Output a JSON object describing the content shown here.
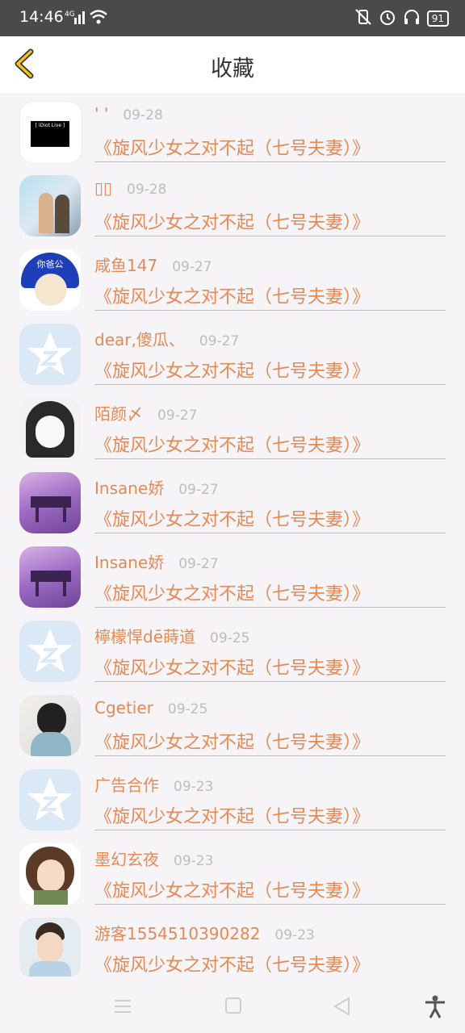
{
  "status": {
    "time": "14:46",
    "network": "4G",
    "battery": "91"
  },
  "header": {
    "title": "收藏"
  },
  "favorites": [
    {
      "name": "' '",
      "date": "09-28",
      "content": "《旋风少女之对不起（七号夫妻）》",
      "avatar": "idiot-live-logo"
    },
    {
      "name": "▯▯",
      "date": "09-28",
      "content": "《旋风少女之对不起（七号夫妻）》",
      "avatar": "couple-photo"
    },
    {
      "name": "咸鱼147",
      "date": "09-27",
      "content": "《旋风少女之对不起（七号夫妻）》",
      "avatar": "helmet-meme"
    },
    {
      "name": "dear,傻瓜、",
      "date": "09-27",
      "content": "《旋风少女之对不起（七号夫妻）》",
      "avatar": "qzone-default"
    },
    {
      "name": "陌颜〆",
      "date": "09-27",
      "content": "《旋风少女之对不起（七号夫妻）》",
      "avatar": "manga-girl"
    },
    {
      "name": "Insane娇",
      "date": "09-27",
      "content": "《旋风少女之对不起（七号夫妻）》",
      "avatar": "purple-piano"
    },
    {
      "name": "Insane娇",
      "date": "09-27",
      "content": "《旋风少女之对不起（七号夫妻）》",
      "avatar": "purple-piano"
    },
    {
      "name": "檸檬悍dē蒔道",
      "date": "09-25",
      "content": "《旋风少女之对不起（七号夫妻）》",
      "avatar": "qzone-default"
    },
    {
      "name": "Cgetier",
      "date": "09-25",
      "content": "《旋风少女之对不起（七号夫妻）》",
      "avatar": "girl-photo"
    },
    {
      "name": "广告合作",
      "date": "09-23",
      "content": "《旋风少女之对不起（七号夫妻）》",
      "avatar": "qzone-default"
    },
    {
      "name": "墨幻玄夜",
      "date": "09-23",
      "content": "《旋风少女之对不起（七号夫妻）》",
      "avatar": "anime-character"
    },
    {
      "name": "游客1554510390282",
      "date": "09-23",
      "content": "《旋风少女之对不起（七号夫妻）》",
      "avatar": "boy-photo"
    }
  ],
  "nav": [
    "menu-icon",
    "home-icon",
    "back-triangle-icon",
    "accessibility-icon"
  ],
  "colors": {
    "accent": "#e38a55",
    "back_arrow": "#f0c419",
    "date": "#bdbdbd"
  }
}
